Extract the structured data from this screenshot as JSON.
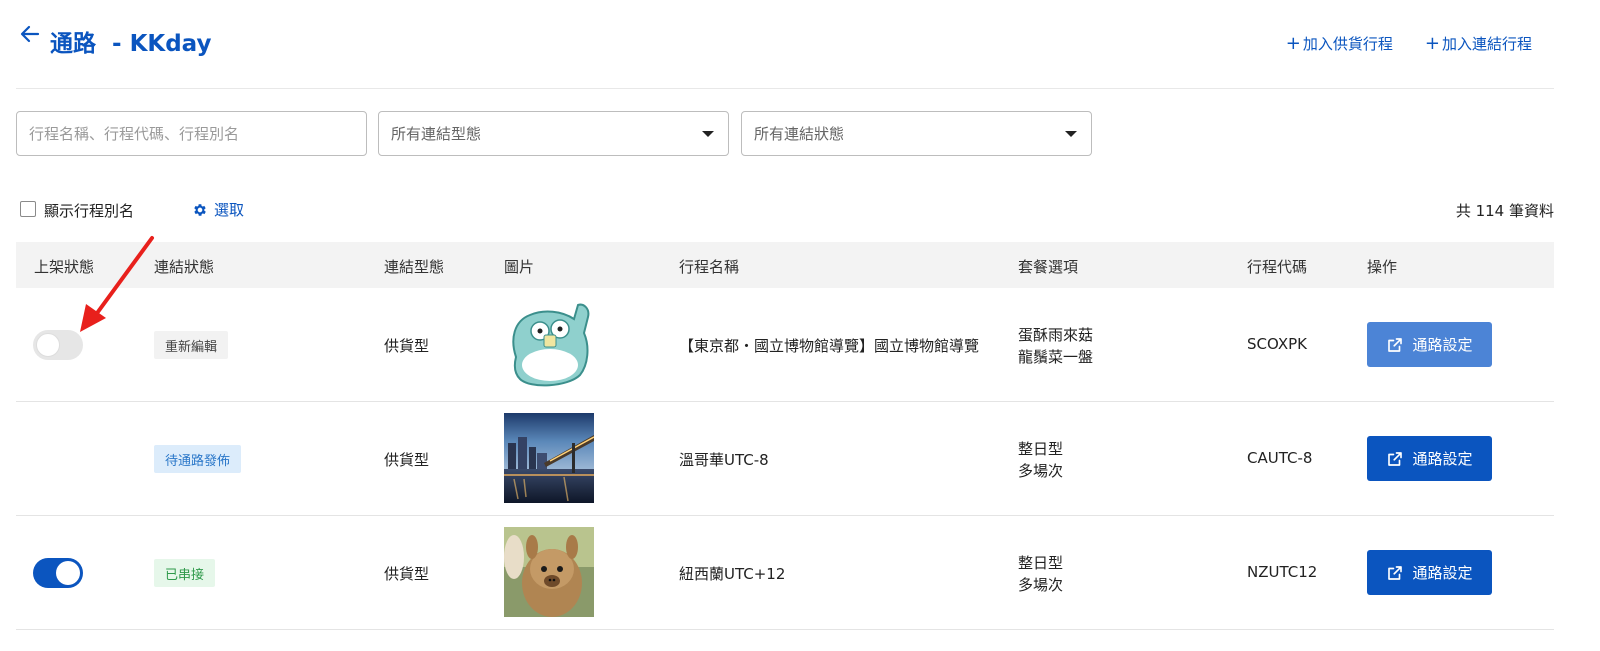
{
  "header": {
    "title": "通路  - KKday",
    "actions": [
      {
        "label": "加入供貨行程"
      },
      {
        "label": "加入連結行程"
      }
    ]
  },
  "filters": {
    "search_placeholder": "行程名稱、行程代碼、行程別名",
    "type_select": "所有連結型態",
    "status_select": "所有連結狀態"
  },
  "toolbar": {
    "show_alias_label": "顯示行程別名",
    "select_label": "選取",
    "total": "共 114 筆資料"
  },
  "table": {
    "columns": [
      "上架狀態",
      "連結狀態",
      "連結型態",
      "圖片",
      "行程名稱",
      "套餐選項",
      "行程代碼",
      "操作"
    ],
    "rows": [
      {
        "listed": "off",
        "link_status": "重新編輯",
        "link_type": "供貨型",
        "image": "penguin-sticker",
        "name": "【東京都・國立博物館導覽】國立博物館導覽",
        "package_line1": "蛋酥雨來菇",
        "package_line2": "龍鬚菜一盤",
        "code": "SCOXPK",
        "action": "通路設定"
      },
      {
        "listed": "none",
        "link_status": "待通路發佈",
        "link_type": "供貨型",
        "image": "vancouver-night-bridge",
        "name": "溫哥華UTC-8",
        "package_line1": "整日型",
        "package_line2": "多場次",
        "code": "CAUTC-8",
        "action": "通路設定"
      },
      {
        "listed": "on",
        "link_status": "已串接",
        "link_type": "供貨型",
        "image": "alpaca-photo",
        "name": "紐西蘭UTC+12",
        "package_line1": "整日型",
        "package_line2": "多場次",
        "code": "NZUTC12",
        "action": "通路設定"
      }
    ]
  },
  "colors": {
    "primary": "#0b55bf",
    "button_light": "#4c84d6",
    "annotation": "#e8201c"
  }
}
